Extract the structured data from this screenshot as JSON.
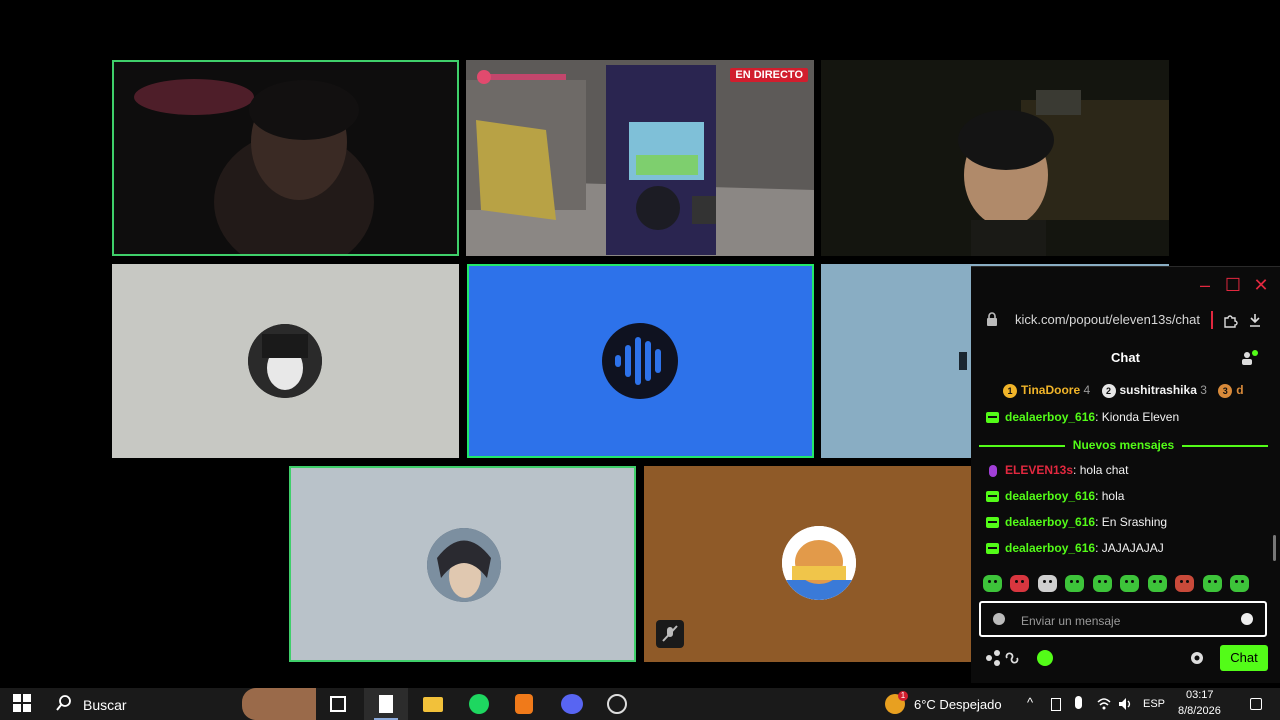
{
  "video_tiles": {
    "live_badge": "EN DIRECTO"
  },
  "chat": {
    "url": "kick.com/popout/eleven13s/chat",
    "title": "Chat",
    "leaderboard": [
      {
        "rank": "1",
        "name": "TinaDoore",
        "count": "4",
        "color": "#f0b429"
      },
      {
        "rank": "2",
        "name": "sushitrashika",
        "count": "3",
        "color": "#e6e6e6"
      },
      {
        "rank": "3",
        "name": "d",
        "count": "",
        "color": "#d88a3a"
      }
    ],
    "old_message": {
      "user": "dealaerboy_616",
      "text": "Kionda Eleven"
    },
    "new_messages_label": "Nuevos mensajes",
    "messages": [
      {
        "user": "ELEVEN13s",
        "text": "hola chat",
        "role": "host"
      },
      {
        "user": "dealaerboy_616",
        "text": "hola",
        "role": "viewer"
      },
      {
        "user": "dealaerboy_616",
        "text": "En Srashing",
        "role": "viewer"
      },
      {
        "user": "dealaerboy_616",
        "text": "JAJAJAJAJ",
        "role": "viewer"
      }
    ],
    "input_placeholder": "Enviar un mensaje",
    "send_label": "Chat",
    "accent": "#53fc18",
    "host_color": "#e2283f"
  },
  "taskbar": {
    "search_label": "Buscar",
    "weather": "6°C Despejado",
    "weather_badge": "1",
    "language": "ESP",
    "time": "03:17",
    "date": "8/8/2026"
  }
}
